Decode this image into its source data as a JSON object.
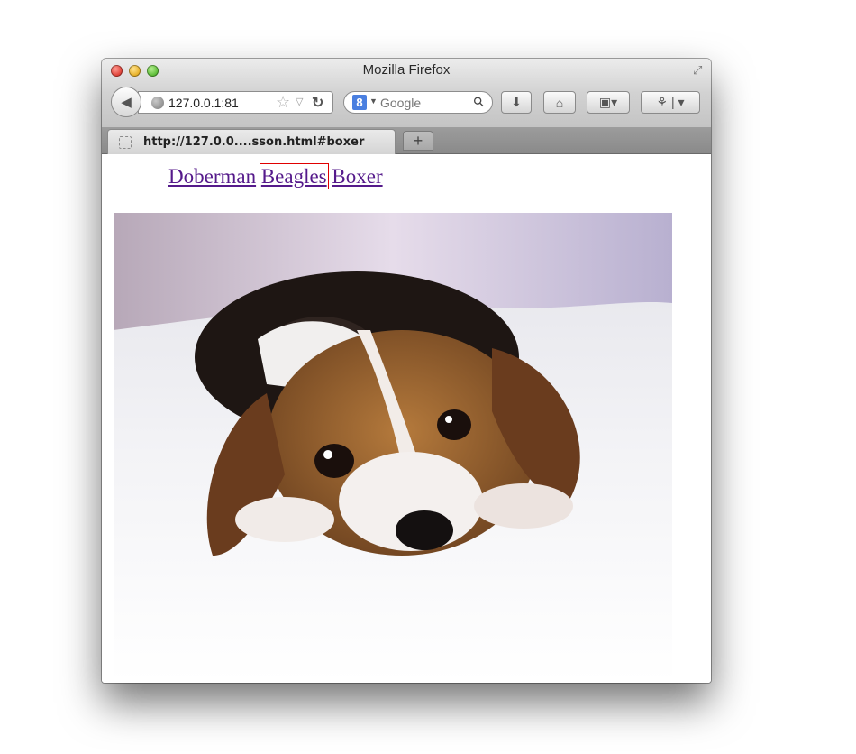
{
  "window": {
    "title": "Mozilla Firefox"
  },
  "toolbar": {
    "url": "127.0.0.1:81",
    "search_placeholder": "Google",
    "search_engine_icon": "google-icon"
  },
  "tabs": [
    {
      "title": "http://127.0.0....sson.html#boxer"
    }
  ],
  "new_tab_label": "+",
  "page": {
    "nav_links": [
      "Doberman",
      "Beagles",
      "Boxer"
    ],
    "focused_link": "Beagles",
    "link_color": "#551a8b",
    "focus_outline_color": "#e00000",
    "image": {
      "subject": "beagle puppy lying on white fur blanket"
    }
  }
}
